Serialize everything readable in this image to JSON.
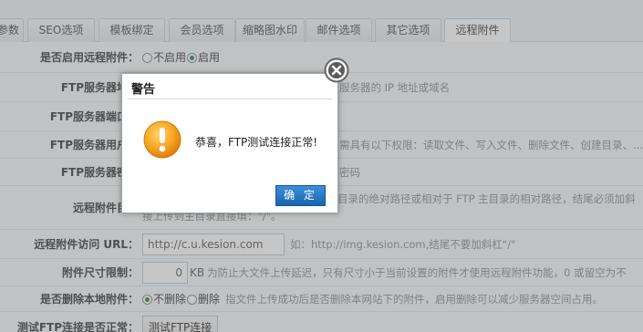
{
  "tabs": [
    {
      "label": "参数"
    },
    {
      "label": "SEO选项"
    },
    {
      "label": "模板绑定"
    },
    {
      "label": "会员选项"
    },
    {
      "label": "缩略图水印"
    },
    {
      "label": "邮件选项"
    },
    {
      "label": "其它选项"
    },
    {
      "label": "远程附件"
    }
  ],
  "active_tab": "远程附件",
  "form": {
    "enable_remote": {
      "label": "是否启用远程附件：",
      "options": [
        "不启用",
        "启用"
      ],
      "selected": "启用"
    },
    "ftp_host": {
      "label": "FTP服务器地址",
      "hint": "服务器的 IP 地址或域名"
    },
    "ftp_port": {
      "label": "FTP服务器端口号"
    },
    "ftp_user": {
      "label": "FTP服务器用户名",
      "hint": "需具有以下权限：读取文件、写入文件、删除文件、创建目录、..."
    },
    "ftp_password": {
      "label": "FTP服务器密码",
      "hint": "密码"
    },
    "remote_dir": {
      "label": "远程附件目录",
      "hint_line1": "目录的绝对路径或相对于 FTP 主目录的相对路径，结尾必须加斜",
      "hint_line2": "接上传到主目录直接填：\"/\"。"
    },
    "remote_url": {
      "label": "远程附件访问 URL：",
      "value": "http://c.u.kesion.com",
      "hint": "如：http://img.kesion.com,结尾不要加斜杠\"/\""
    },
    "size_limit": {
      "label": "附件尺寸限制：",
      "value": "0",
      "unit": "KB",
      "hint": "为防止大文件上传延迟，只有尺寸小于当前设置的附件才使用远程附件功能，0 或留空为不"
    },
    "delete_local": {
      "label": "是否删除本地附件：",
      "options": [
        "不删除",
        "删除"
      ],
      "selected": "不删除",
      "hint": "指文件上传成功后是否删除本网站下的附件，启用删除可以减少服务器空间占用。"
    },
    "test_connection": {
      "label": "测试FTP连接是否正常：",
      "button": "测试FTP连接"
    }
  },
  "dialog": {
    "title": "警告",
    "message": "恭喜，FTP测试连接正常!",
    "ok_label": "确 定",
    "icon": "warning-icon"
  },
  "colors": {
    "ok_button": "#1f6fbf",
    "warning_icon": "#f29a1a",
    "overlay": "#787878"
  }
}
